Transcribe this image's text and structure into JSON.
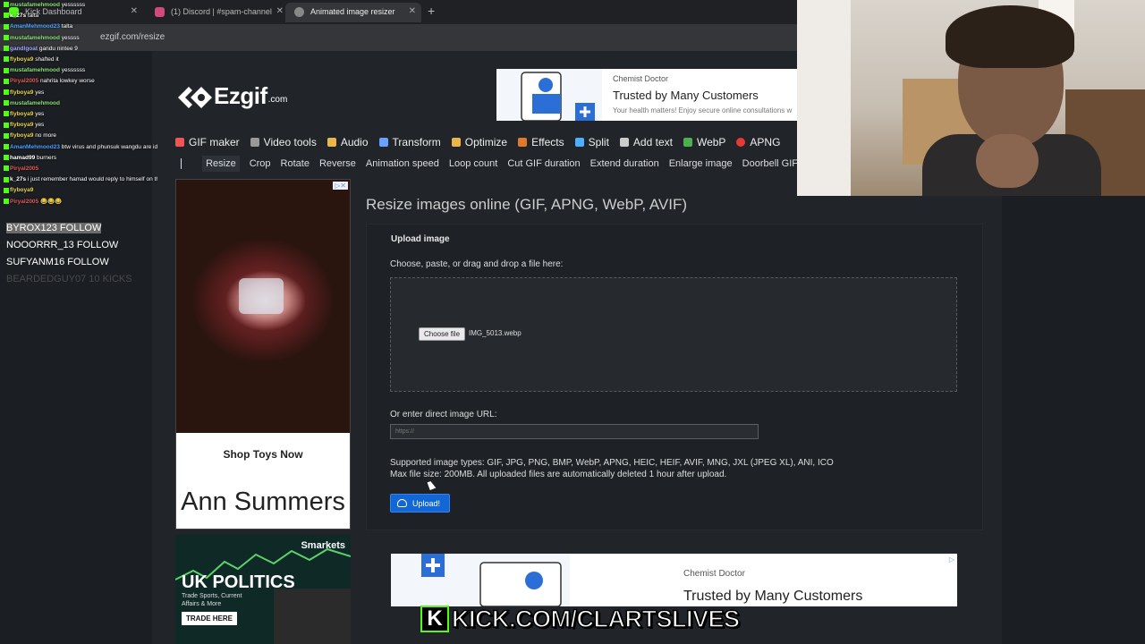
{
  "browser": {
    "tabs": [
      {
        "label": "Kick Dashboard",
        "active": false
      },
      {
        "label": "(1) Discord | #spam-channel",
        "active": false
      },
      {
        "label": "Animated image resizer",
        "active": true
      }
    ],
    "url": "ezgif.com/resize"
  },
  "site": {
    "logo_text": "Ezgif",
    "logo_suffix": ".com",
    "main_nav": [
      {
        "label": "GIF maker",
        "icon": "gif-icon",
        "color": "#e55"
      },
      {
        "label": "Video tools",
        "icon": "video-icon",
        "color": "#999"
      },
      {
        "label": "Audio",
        "icon": "audio-icon",
        "color": "#e8b64b"
      },
      {
        "label": "Transform",
        "icon": "transform-icon",
        "color": "#6aa0ff"
      },
      {
        "label": "Optimize",
        "icon": "optimize-icon",
        "color": "#e8b64b"
      },
      {
        "label": "Effects",
        "icon": "effects-icon",
        "color": "#e07a2a"
      },
      {
        "label": "Split",
        "icon": "split-icon",
        "color": "#4ab0ff"
      },
      {
        "label": "Add text",
        "icon": "text-icon",
        "color": "#cccccc"
      },
      {
        "label": "WebP",
        "icon": "webp-icon",
        "color": "#4caf50"
      },
      {
        "label": "APNG",
        "icon": "apng-icon",
        "color": "#e53935"
      }
    ],
    "sub_nav": [
      "Resize",
      "Crop",
      "Rotate",
      "Reverse",
      "Animation speed",
      "Loop count",
      "Cut GIF duration",
      "Extend duration",
      "Enlarge image",
      "Doorbell GIF"
    ],
    "page_title": "Resize images online (GIF, APNG, WebP, AVIF)",
    "upload_heading": "Upload image",
    "choose_label": "Choose, paste, or drag and drop a file here:",
    "file_button": "Choose file",
    "file_name": "IMG_5013.webp",
    "url_label": "Or enter direct image URL:",
    "url_placeholder": "https://",
    "supported": "Supported image types: GIF, JPG, PNG, BMP, WebP, APNG, HEIC, HEIF, AVIF, MNG, JXL (JPEG XL), ANI, ICO",
    "max_size": "Max file size: 200MB. All uploaded files are automatically deleted 1 hour after upload.",
    "upload_button": "Upload!"
  },
  "ads": {
    "top": {
      "brand": "Chemist Doctor",
      "headline": "Trusted by Many Customers",
      "sub": "Your health matters! Enjoy secure online consultations w"
    },
    "left": {
      "cta": "Shop Toys Now",
      "brand": "Ann Summers"
    },
    "left2": {
      "brand": "Smarkets",
      "headline": "UK POLITICS",
      "body": "Trade Sports, Current\nAffairs & More",
      "button": "TRADE HERE"
    },
    "bottom": {
      "brand": "Chemist Doctor",
      "headline": "Trusted by Many Customers"
    }
  },
  "chat": [
    {
      "user": "mustafamehmood",
      "color": "#8be07a",
      "msg": "yessssss"
    },
    {
      "user": "k_27s",
      "color": "#ffffff",
      "msg": "talta"
    },
    {
      "user": "AmanMehmood23",
      "color": "#4aa0ff",
      "msg": "talta"
    },
    {
      "user": "mustafamehmood",
      "color": "#8be07a",
      "msg": "yessss"
    },
    {
      "user": "gandlgoat",
      "color": "#9aa7ff",
      "msg": "gandu nintee 9"
    },
    {
      "user": "flyboya9",
      "color": "#e8d44a",
      "msg": "shafted it"
    },
    {
      "user": "mustafamehmood",
      "color": "#8be07a",
      "msg": "yessssss"
    },
    {
      "user": "Piryal2005",
      "color": "#e05a5a",
      "msg": "nahrita lowkey worse"
    },
    {
      "user": "flyboya9",
      "color": "#e8d44a",
      "msg": "yes"
    },
    {
      "user": "mustafamehmood",
      "color": "#8be07a",
      "msg": ""
    },
    {
      "user": "flyboya9",
      "color": "#e8d44a",
      "msg": "yes"
    },
    {
      "user": "flyboya9",
      "color": "#e8d44a",
      "msg": "yes"
    },
    {
      "user": "flyboya9",
      "color": "#e8d44a",
      "msg": "no more"
    },
    {
      "user": "AmanMehmood23",
      "color": "#4aa0ff",
      "msg": "btw virus and phunsuk wangdu are identical"
    },
    {
      "user": "hamad99",
      "color": "#ffffff",
      "msg": "burners"
    },
    {
      "user": "Piryal2005",
      "color": "#e05a5a",
      "msg": ""
    },
    {
      "user": "k_27s",
      "color": "#ffffff",
      "msg": "i just remember hamad would reply to himself on the lives. idk about now"
    },
    {
      "user": "flyboya9",
      "color": "#e8d44a",
      "msg": ""
    },
    {
      "user": "Piryal2005",
      "color": "#e05a5a",
      "msg": "😂😂😂"
    }
  ],
  "follows": [
    {
      "text": "BYROX123  FOLLOW",
      "style": "hl"
    },
    {
      "text": "NOOORRR_13  FOLLOW",
      "style": ""
    },
    {
      "text": "SUFYANM16  FOLLOW",
      "style": ""
    },
    {
      "text": "BEARDEDGUY07  10 KICKS",
      "style": "dim"
    }
  ],
  "kick_banner": "KICK.COM/CLARTSLIVES",
  "kick_letter": "K"
}
